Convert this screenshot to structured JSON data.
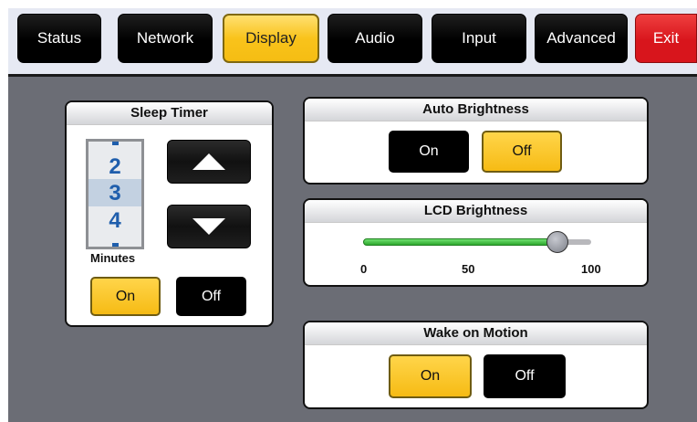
{
  "tabs": [
    {
      "label": "Status",
      "active": false
    },
    {
      "label": "Network",
      "active": false
    },
    {
      "label": "Display",
      "active": true
    },
    {
      "label": "Audio",
      "active": false
    },
    {
      "label": "Input",
      "active": false
    },
    {
      "label": "Advanced",
      "active": false
    },
    {
      "label": "Exit",
      "active": false
    }
  ],
  "sleep_timer": {
    "title": "Sleep Timer",
    "values": [
      "2",
      "3",
      "4"
    ],
    "selected": "3",
    "unit_label": "Minutes",
    "up_icon": "triangle-up-icon",
    "down_icon": "triangle-down-icon",
    "on_label": "On",
    "off_label": "Off",
    "state": "On"
  },
  "auto_brightness": {
    "title": "Auto Brightness",
    "on_label": "On",
    "off_label": "Off",
    "state": "Off"
  },
  "lcd_brightness": {
    "title": "LCD Brightness",
    "min_label": "0",
    "mid_label": "50",
    "max_label": "100",
    "value_fraction": 0.85
  },
  "wake_on_motion": {
    "title": "Wake on Motion",
    "on_label": "On",
    "off_label": "Off",
    "state": "On"
  },
  "colors": {
    "accent_yellow": "#f9c31b",
    "exit_red": "#d8151c",
    "background_gray": "#6b6d75",
    "slider_green": "#3db33d",
    "spinner_blue": "#1f5eac"
  }
}
